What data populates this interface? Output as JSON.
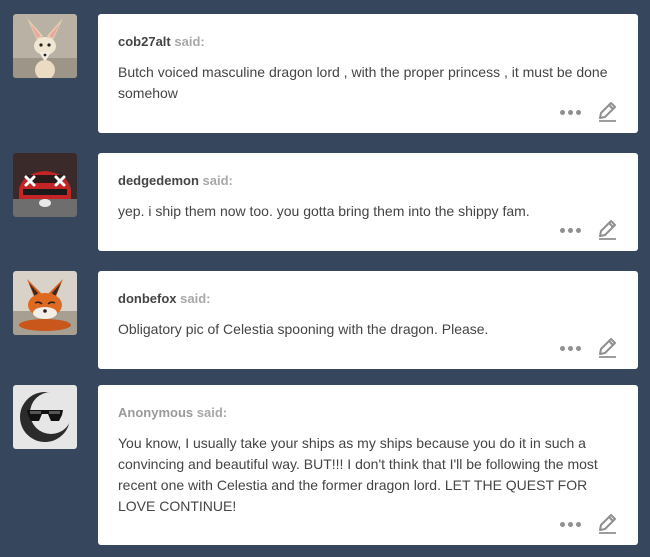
{
  "said_label": "said:",
  "asks": [
    {
      "asker": "cob27alt",
      "question": "Butch voiced masculine dragon lord , with the proper princess , it must be done somehow",
      "avatar": "fennec-fox-avatar"
    },
    {
      "asker": "dedgedemon",
      "question": "yep. i ship them now too. you gotta bring them into the shippy fam.",
      "avatar": "red-car-avatar"
    },
    {
      "asker": "donbefox",
      "question": "Obligatory pic of Celestia spooning with the dragon. Please.",
      "avatar": "red-fox-avatar"
    },
    {
      "asker": "Anonymous",
      "question": "You know, I usually take your ships as my ships because you do it in such a convincing and beautiful way. BUT!!! I don't think that I'll be following the most recent one with Celestia and the former dragon lord. LET THE QUEST FOR LOVE CONTINUE!",
      "avatar": "anonymous-sunglasses-avatar"
    }
  ],
  "icons": {
    "more": "more-options-icon",
    "edit": "edit-pencil-icon"
  },
  "colors": {
    "background": "#36465d",
    "card": "#ffffff",
    "text": "#444444",
    "said": "#a7a7a7",
    "icon": "#8f8f8f"
  }
}
